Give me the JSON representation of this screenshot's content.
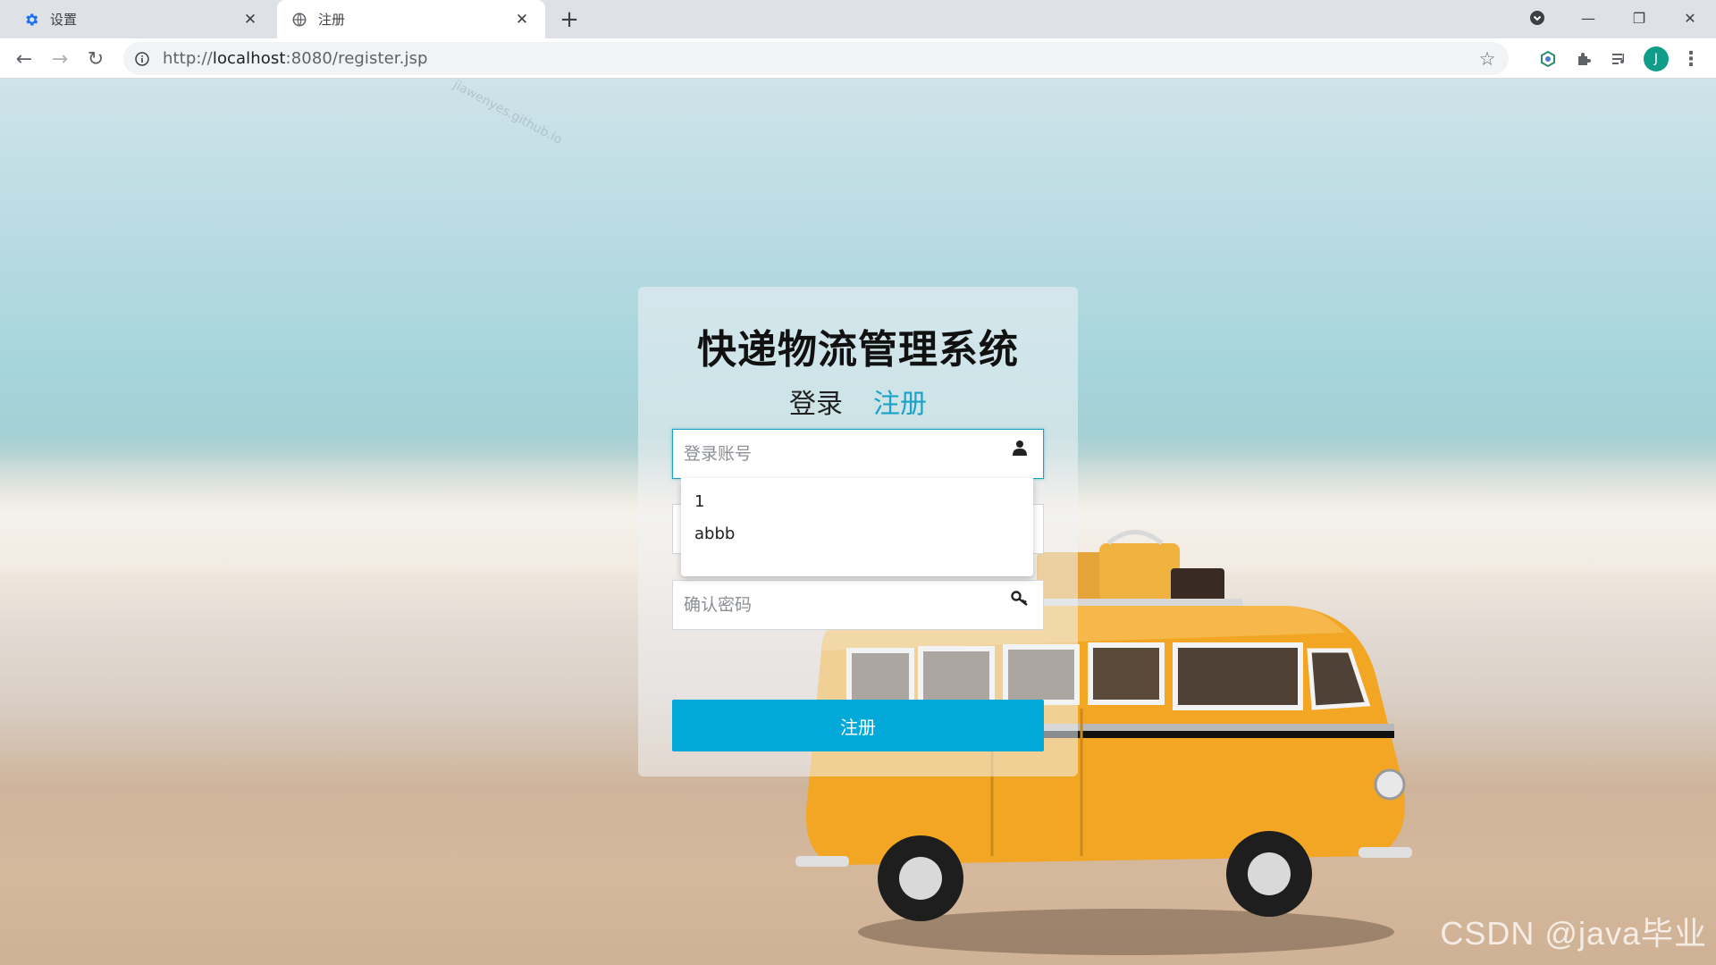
{
  "browser": {
    "tabs": [
      {
        "title": "设置",
        "icon": "gear-icon",
        "active": false
      },
      {
        "title": "注册",
        "icon": "globe-icon",
        "active": true
      }
    ],
    "new_tab": "+",
    "url_scheme": "http://",
    "url_host": "localhost",
    "url_rest": ":8080/register.jsp",
    "profile_initial": "J"
  },
  "page": {
    "title": "快递物流管理系统",
    "tab_login": "登录",
    "tab_register": "注册",
    "account_placeholder": "登录账号",
    "confirm_password_placeholder": "确认密码",
    "autocomplete_items": [
      "1",
      "abbb"
    ],
    "submit_label": "注册",
    "accent_color": "#03a9d8",
    "watermark": "CSDN @java毕业"
  }
}
